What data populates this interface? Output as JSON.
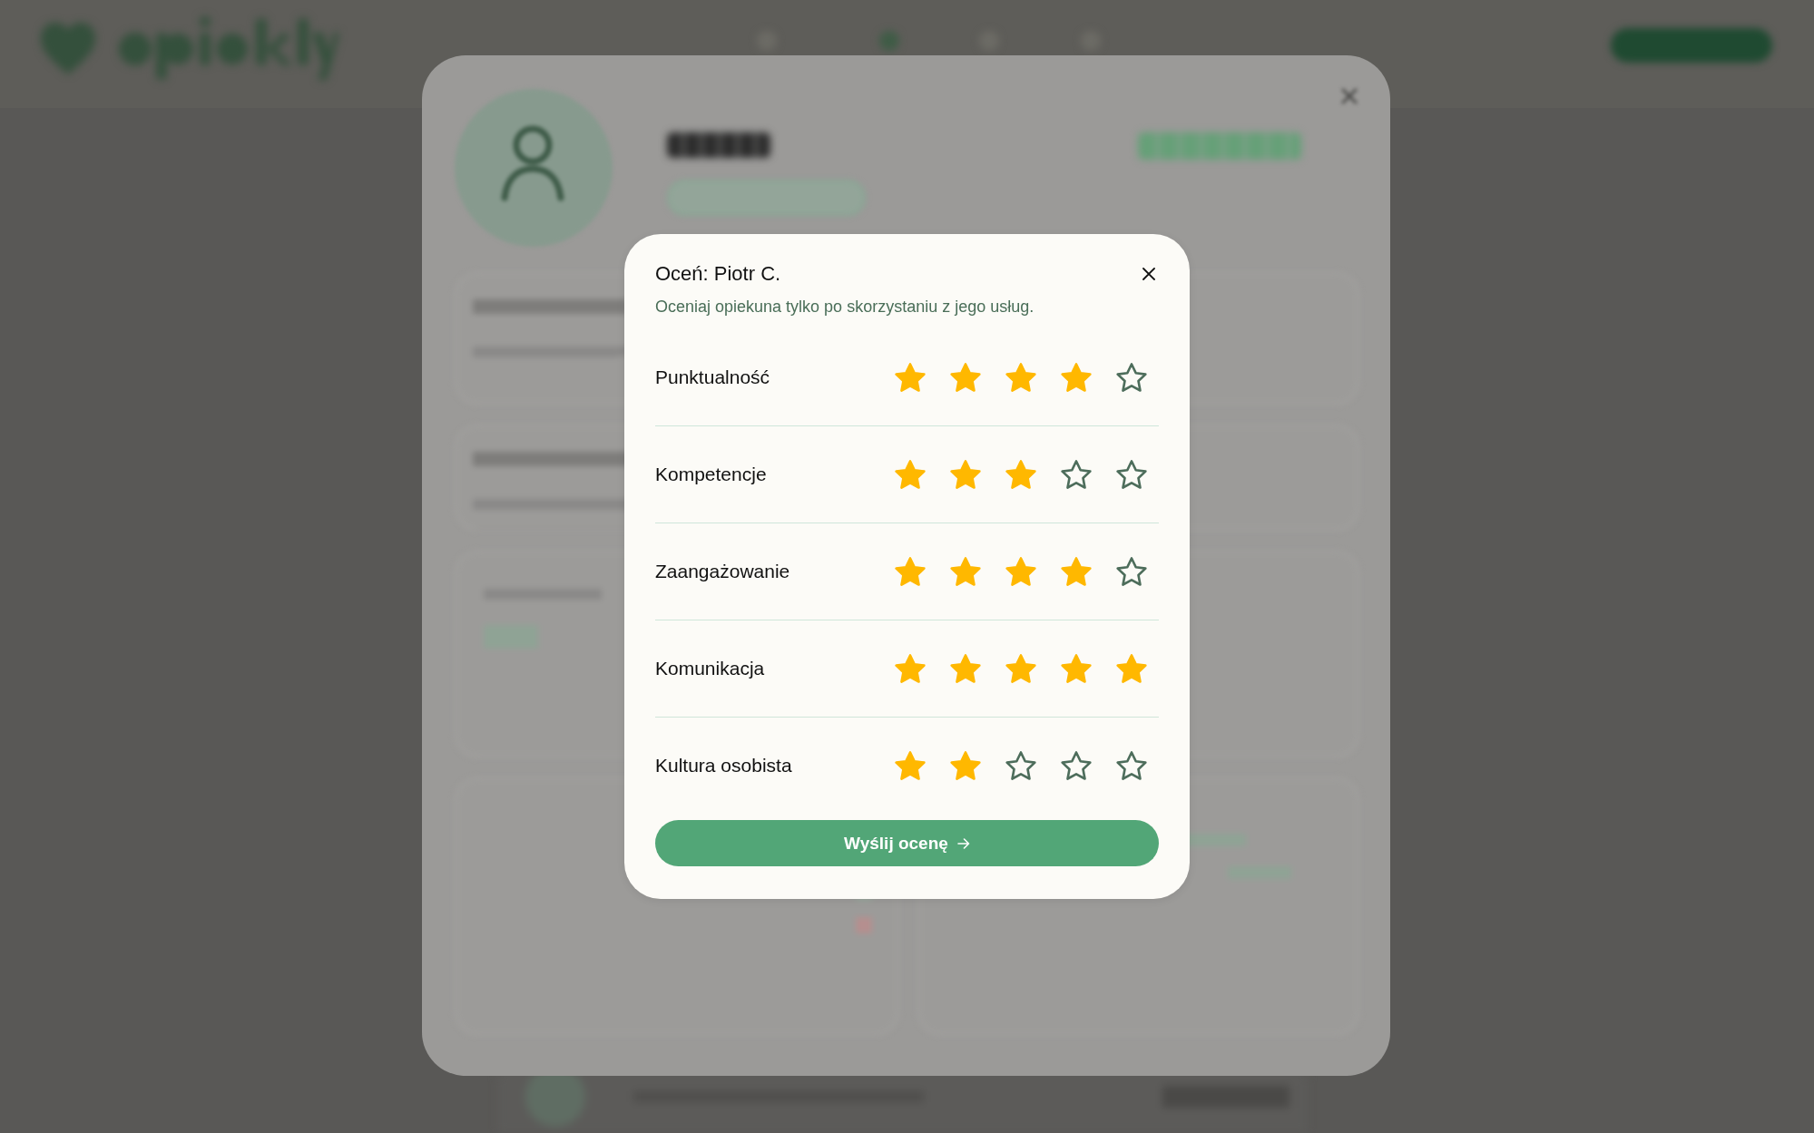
{
  "rating_dialog": {
    "title": "Oceń: Piotr C.",
    "subtitle": "Oceniaj opiekuna tylko po skorzystaniu z jego usług.",
    "criteria": [
      {
        "label": "Punktualność",
        "stars": 4
      },
      {
        "label": "Kompetencje",
        "stars": 3
      },
      {
        "label": "Zaangażowanie",
        "stars": 4
      },
      {
        "label": "Komunikacja",
        "stars": 5
      },
      {
        "label": "Kultura osobista",
        "stars": 2
      }
    ],
    "submit_button": "Wyślij ocenę"
  }
}
